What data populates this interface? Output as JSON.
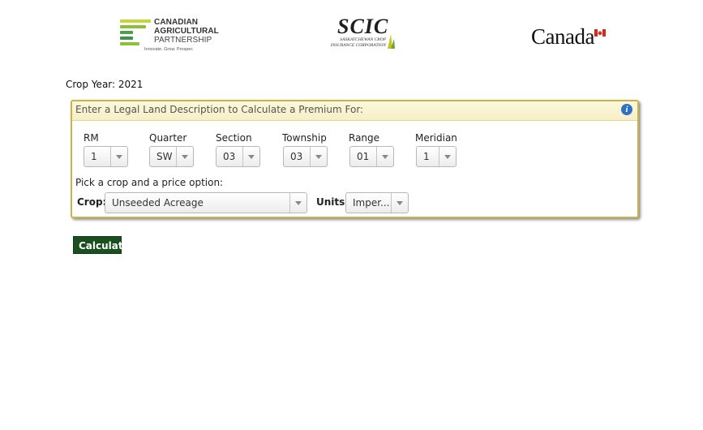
{
  "logos": {
    "cap": {
      "line1": "CANADIAN",
      "line2": "AGRICULTURAL",
      "line3": "PARTNERSHIP",
      "tagline": "Innovate. Grow. Prosper.",
      "bar_colors": [
        "#c7d43b",
        "#8fbf3a",
        "#4aa14a",
        "#2f8a4a"
      ]
    },
    "scic": {
      "main": "SCIC",
      "sub_line1": "SASKATCHEWAN CROP",
      "sub_line2": "INSURANCE CORPORATION"
    },
    "canada": {
      "wordmark": "Canada",
      "flag_color": "#d52b1e"
    }
  },
  "crop_year": {
    "label": "Crop Year:",
    "value": "2021"
  },
  "panel": {
    "title": "Enter a Legal Land Description to Calculate a Premium For:",
    "info_icon": "info-icon",
    "fields": [
      {
        "label": "RM",
        "value": "1"
      },
      {
        "label": "Quarter",
        "value": "SW"
      },
      {
        "label": "Section",
        "value": "03"
      },
      {
        "label": "Township",
        "value": "03"
      },
      {
        "label": "Range",
        "value": "01"
      },
      {
        "label": "Meridian",
        "value": "1"
      }
    ],
    "pick_label": "Pick a crop and a price option:",
    "crop": {
      "label": "Crop:",
      "value": "Unseeded Acreage"
    },
    "units": {
      "label": "Units:",
      "value": "Imper..."
    }
  },
  "calculate_label": "Calculate",
  "colors": {
    "panel_border": "#c9b44a",
    "button_bg": "#1a4f1f",
    "info_blue": "#2f72c4"
  }
}
